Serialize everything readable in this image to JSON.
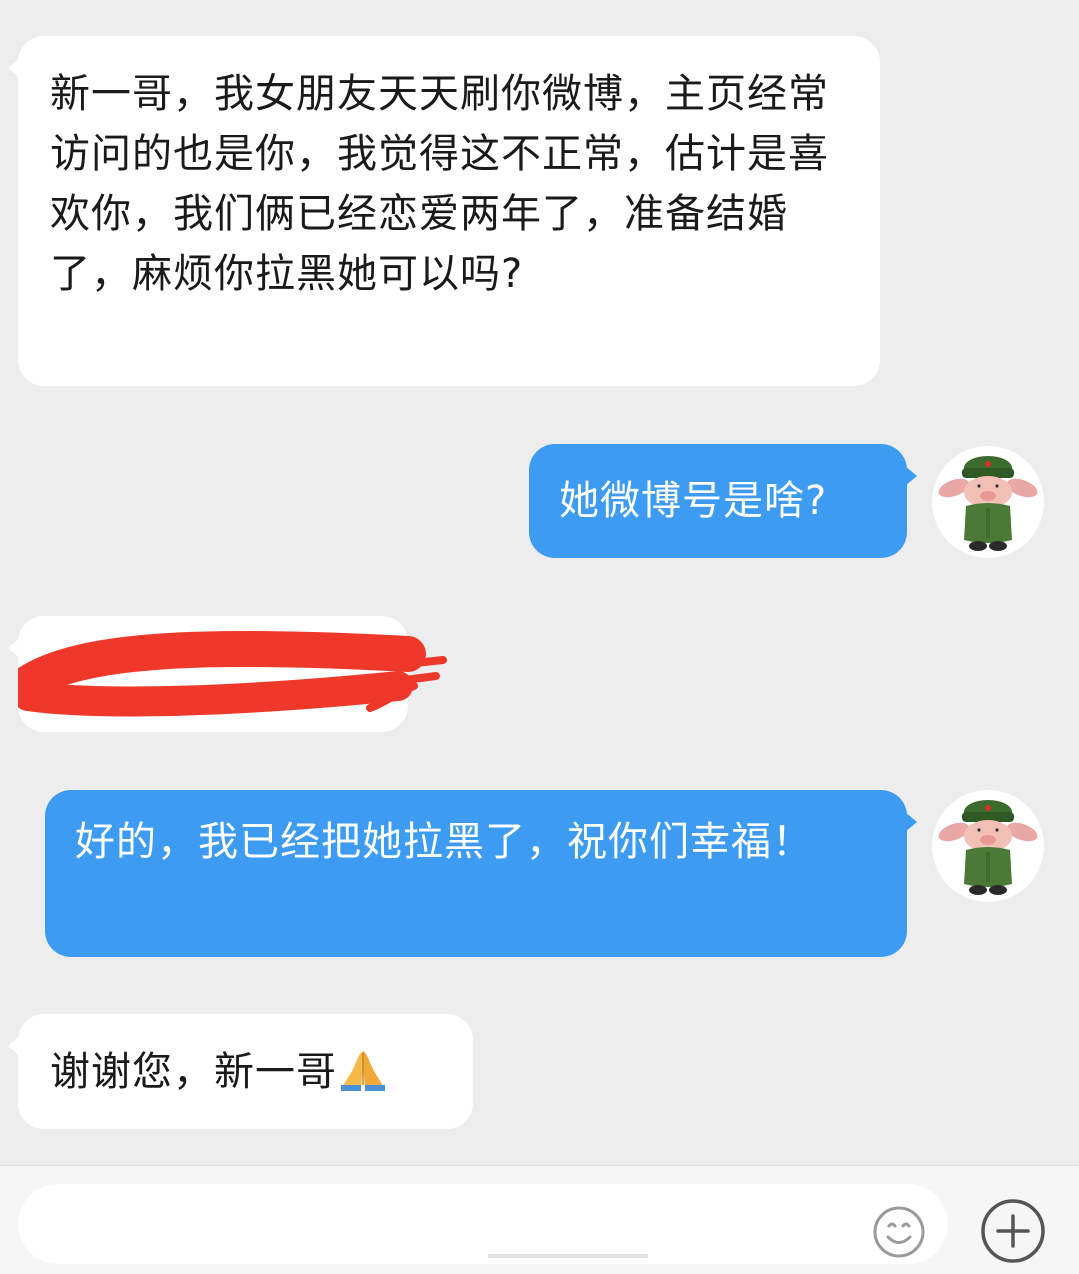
{
  "messages": [
    {
      "sender": "other",
      "text": "新一哥，我女朋友天天刷你微博，主页经常访问的也是你，我觉得这不正常，估计是喜欢你，我们俩已经恋爱两年了，准备结婚了，麻烦你拉黑她可以吗?"
    },
    {
      "sender": "self",
      "text": "她微博号是啥?"
    },
    {
      "sender": "other",
      "text": "",
      "redacted": true
    },
    {
      "sender": "self",
      "text": "好的，我已经把她拉黑了，祝你们幸福！"
    },
    {
      "sender": "other",
      "text": "谢谢您，新一哥",
      "emoji": "folded-hands"
    }
  ],
  "input": {
    "placeholder": ""
  },
  "colors": {
    "background": "#ededed",
    "incoming_bubble": "#ffffff",
    "outgoing_bubble": "#3d9bf2",
    "redaction": "#f0382a"
  },
  "icons": [
    "avatar-pig-soldier",
    "emoji-icon",
    "plus-icon"
  ]
}
